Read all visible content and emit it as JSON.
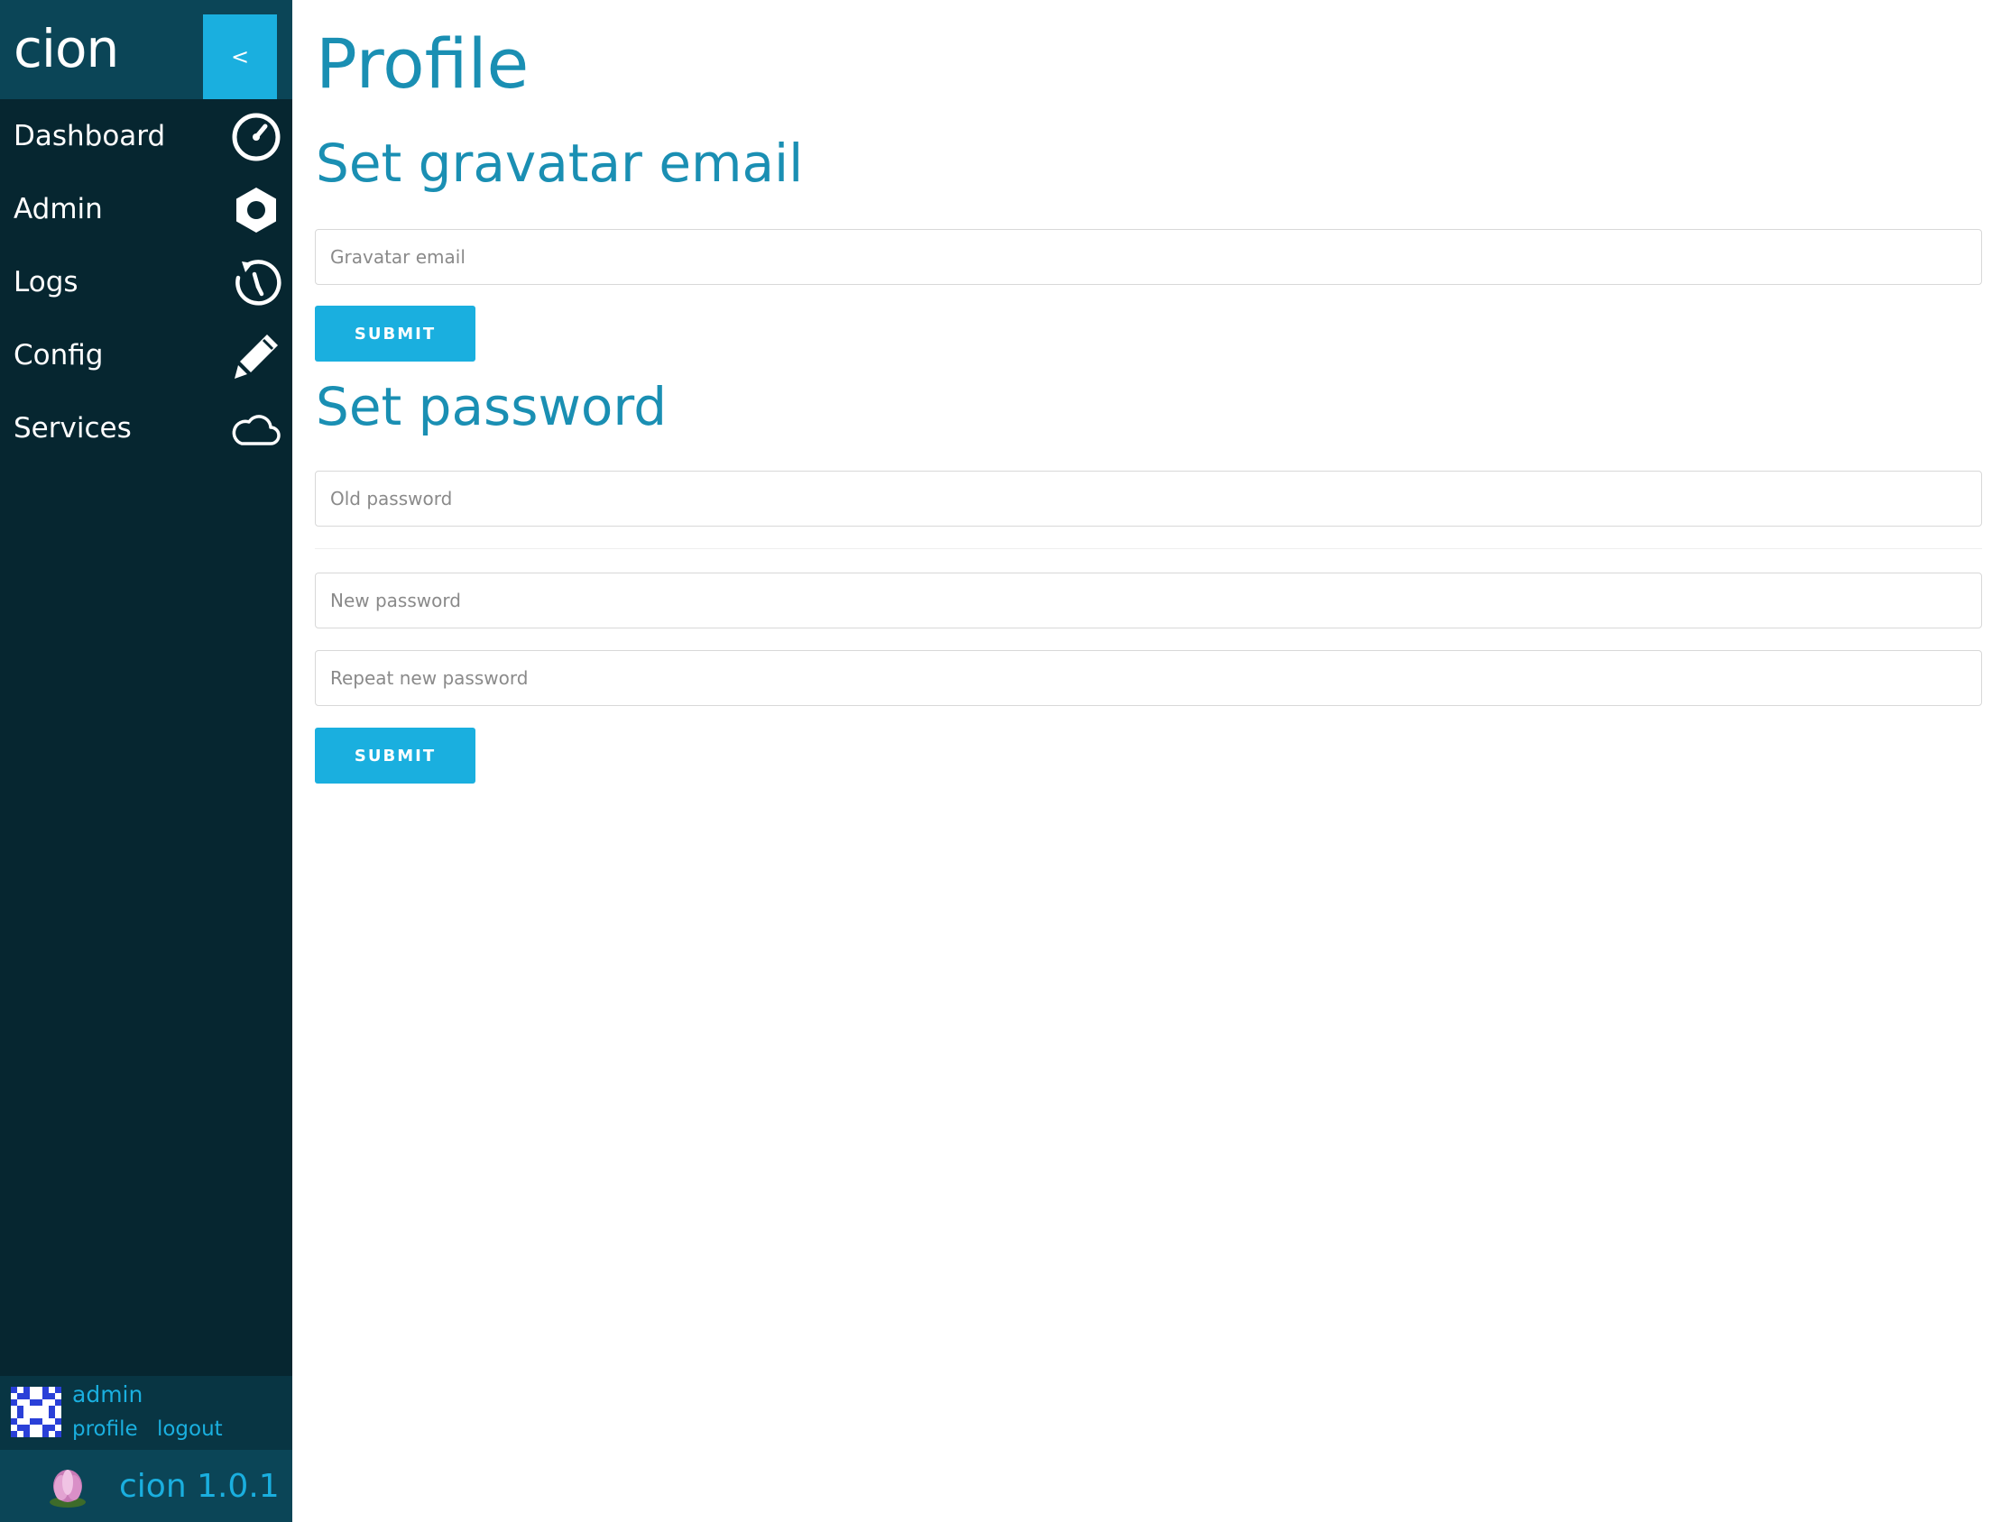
{
  "app": {
    "brand": "cion",
    "collapse_label": "<"
  },
  "sidebar": {
    "items": [
      {
        "label": "Dashboard",
        "icon": "dashboard-gauge-icon"
      },
      {
        "label": "Admin",
        "icon": "hexagon-icon"
      },
      {
        "label": "Logs",
        "icon": "history-icon"
      },
      {
        "label": "Config",
        "icon": "pencil-icon"
      },
      {
        "label": "Services",
        "icon": "cloud-icon"
      }
    ]
  },
  "user": {
    "name": "admin",
    "profile_link": "profile",
    "logout_link": "logout"
  },
  "footer": {
    "version": "cion 1.0.1"
  },
  "main": {
    "title": "Profile",
    "gravatar": {
      "heading": "Set gravatar email",
      "email_placeholder": "Gravatar email",
      "submit_label": "SUBMIT"
    },
    "password": {
      "heading": "Set password",
      "old_placeholder": "Old password",
      "new_placeholder": "New password",
      "repeat_placeholder": "Repeat new password",
      "submit_label": "SUBMIT"
    }
  },
  "colors": {
    "sidebar_bg": "#062630",
    "brand_bar_bg": "#0b4557",
    "accent": "#1aafdf",
    "heading": "#1a8fb3"
  }
}
